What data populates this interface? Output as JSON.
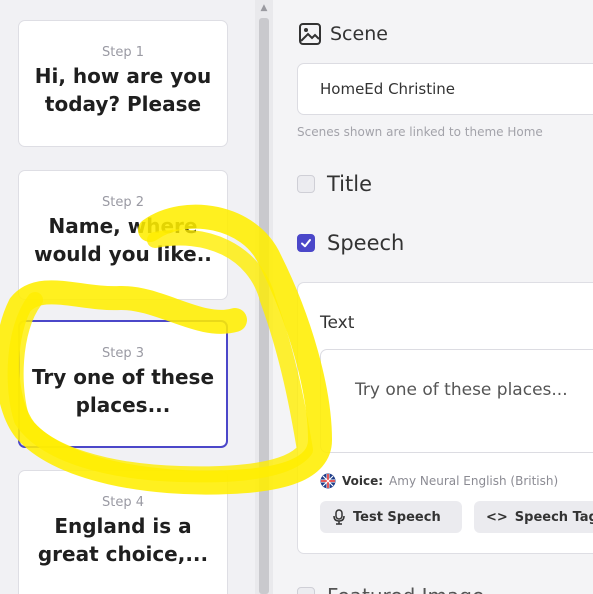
{
  "steps": [
    {
      "label": "Step 1",
      "text": "Hi, how are you today? Please"
    },
    {
      "label": "Step 2",
      "text": "Name, where would you like.."
    },
    {
      "label": "Step 3",
      "text": "Try one of these places..."
    },
    {
      "label": "Step 4",
      "text": "England is a great choice,..."
    }
  ],
  "scene": {
    "heading": "Scene",
    "value": "HomeEd Christine",
    "hint": "Scenes shown are linked to theme Home"
  },
  "options": {
    "title_label": "Title",
    "speech_label": "Speech",
    "featured_label": "Featured Image"
  },
  "speech": {
    "text_label": "Text",
    "text_value": "Try one of these places...",
    "voice_prefix": "Voice:",
    "voice_value": "Amy Neural English (British)",
    "test_button": "Test Speech",
    "tags_button": "Speech Tags"
  },
  "colors": {
    "accent": "#4b47c9",
    "highlight": "#ffee00"
  }
}
